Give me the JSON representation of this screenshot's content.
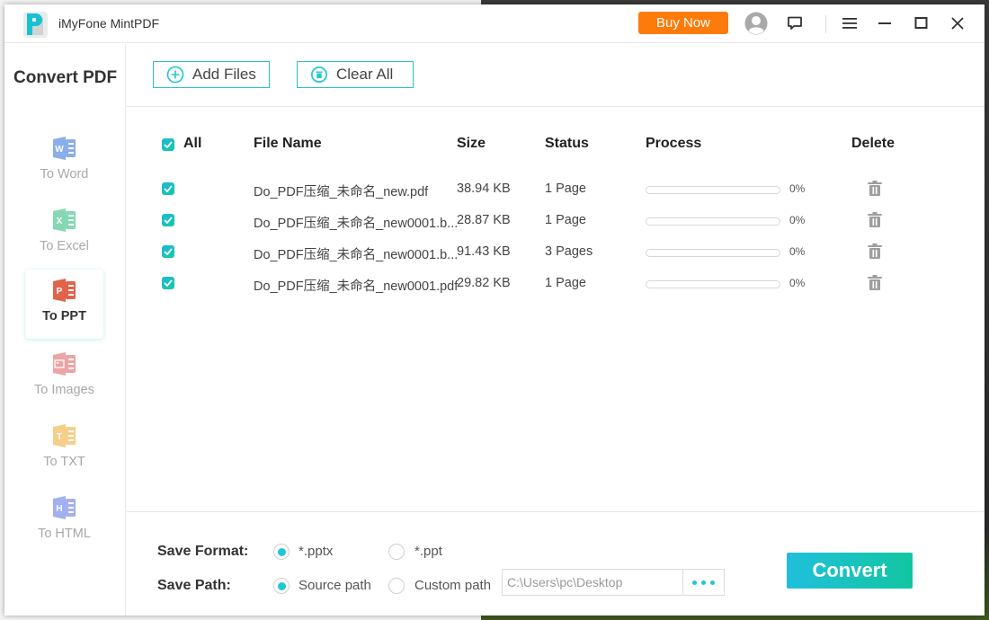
{
  "app": {
    "title": "iMyFone MintPDF",
    "buy_label": "Buy Now",
    "colors": {
      "accent": "#1ec8d3",
      "buy": "#fd7b0a"
    },
    "icons": [
      "account-icon",
      "feedback-icon",
      "menu-icon",
      "minimize-icon",
      "maximize-icon",
      "close-icon"
    ]
  },
  "sidebar": {
    "title": "Convert PDF",
    "items": [
      {
        "label": "To Word",
        "letter": "W",
        "color": "#8aaee8",
        "active": false
      },
      {
        "label": "To Excel",
        "letter": "X",
        "color": "#86d8b3",
        "active": false
      },
      {
        "label": "To PPT",
        "letter": "P",
        "color": "#e0644a",
        "active": true
      },
      {
        "label": "To Images",
        "letter": "img",
        "color": "#eda4a4",
        "active": false
      },
      {
        "label": "To TXT",
        "letter": "T",
        "color": "#f5cf8a",
        "active": false
      },
      {
        "label": "To HTML",
        "letter": "H",
        "color": "#a3b0ef",
        "active": false
      }
    ]
  },
  "toolbar": {
    "add_files": "Add Files",
    "clear_all": "Clear All"
  },
  "table": {
    "headers": {
      "all": "All",
      "file_name": "File Name",
      "size": "Size",
      "status": "Status",
      "process": "Process",
      "delete": "Delete"
    },
    "rows": [
      {
        "checked": true,
        "name": "Do_PDF压缩_未命名_new.pdf",
        "size": "38.94 KB",
        "status": "1 Page",
        "progress": 0,
        "progress_label": "0%"
      },
      {
        "checked": true,
        "name": "Do_PDF压缩_未命名_new0001.b...",
        "size": "28.87 KB",
        "status": "1 Page",
        "progress": 0,
        "progress_label": "0%"
      },
      {
        "checked": true,
        "name": "Do_PDF压缩_未命名_new0001.b...",
        "size": "91.43 KB",
        "status": "3 Pages",
        "progress": 0,
        "progress_label": "0%"
      },
      {
        "checked": true,
        "name": "Do_PDF压缩_未命名_new0001.pdf",
        "size": "29.82 KB",
        "status": "1 Page",
        "progress": 0,
        "progress_label": "0%"
      }
    ]
  },
  "footer": {
    "save_format_label": "Save Format:",
    "format_options": [
      {
        "label": "*.pptx",
        "selected": true
      },
      {
        "label": "*.ppt",
        "selected": false
      }
    ],
    "save_path_label": "Save Path:",
    "path_options": [
      {
        "label": "Source path",
        "selected": true
      },
      {
        "label": "Custom path",
        "selected": false
      }
    ],
    "custom_path_value": "C:\\Users\\pc\\Desktop",
    "convert_label": "Convert"
  }
}
